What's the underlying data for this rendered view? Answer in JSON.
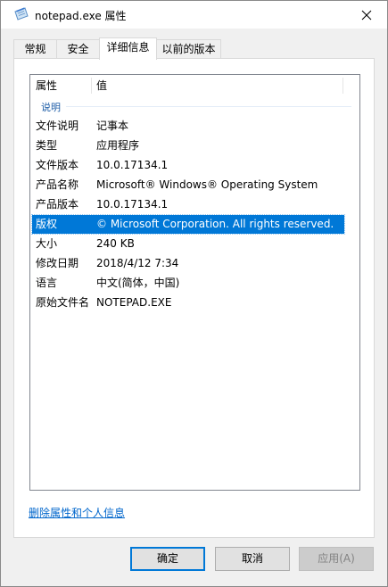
{
  "window": {
    "title": "notepad.exe 属性",
    "close_glyph": "✕"
  },
  "tabs": [
    {
      "label": "常规",
      "active": false
    },
    {
      "label": "安全",
      "active": false
    },
    {
      "label": "详细信息",
      "active": true
    },
    {
      "label": "以前的版本",
      "active": false
    }
  ],
  "details": {
    "columns": {
      "property": "属性",
      "value": "值"
    },
    "group": "说明",
    "rows": [
      {
        "key": "文件说明",
        "value": "记事本"
      },
      {
        "key": "类型",
        "value": "应用程序"
      },
      {
        "key": "文件版本",
        "value": "10.0.17134.1"
      },
      {
        "key": "产品名称",
        "value": "Microsoft® Windows® Operating System"
      },
      {
        "key": "产品版本",
        "value": "10.0.17134.1"
      },
      {
        "key": "版权",
        "value": "© Microsoft Corporation. All rights reserved.",
        "selected": true
      },
      {
        "key": "大小",
        "value": "240 KB"
      },
      {
        "key": "修改日期",
        "value": "2018/4/12 7:34"
      },
      {
        "key": "语言",
        "value": "中文(简体，中国)"
      },
      {
        "key": "原始文件名",
        "value": "NOTEPAD.EXE"
      }
    ]
  },
  "remove_link": "删除属性和个人信息",
  "buttons": {
    "ok": "确定",
    "cancel": "取消",
    "apply": "应用(A)"
  },
  "colors": {
    "selection": "#0078d7",
    "link": "#0066cc"
  }
}
